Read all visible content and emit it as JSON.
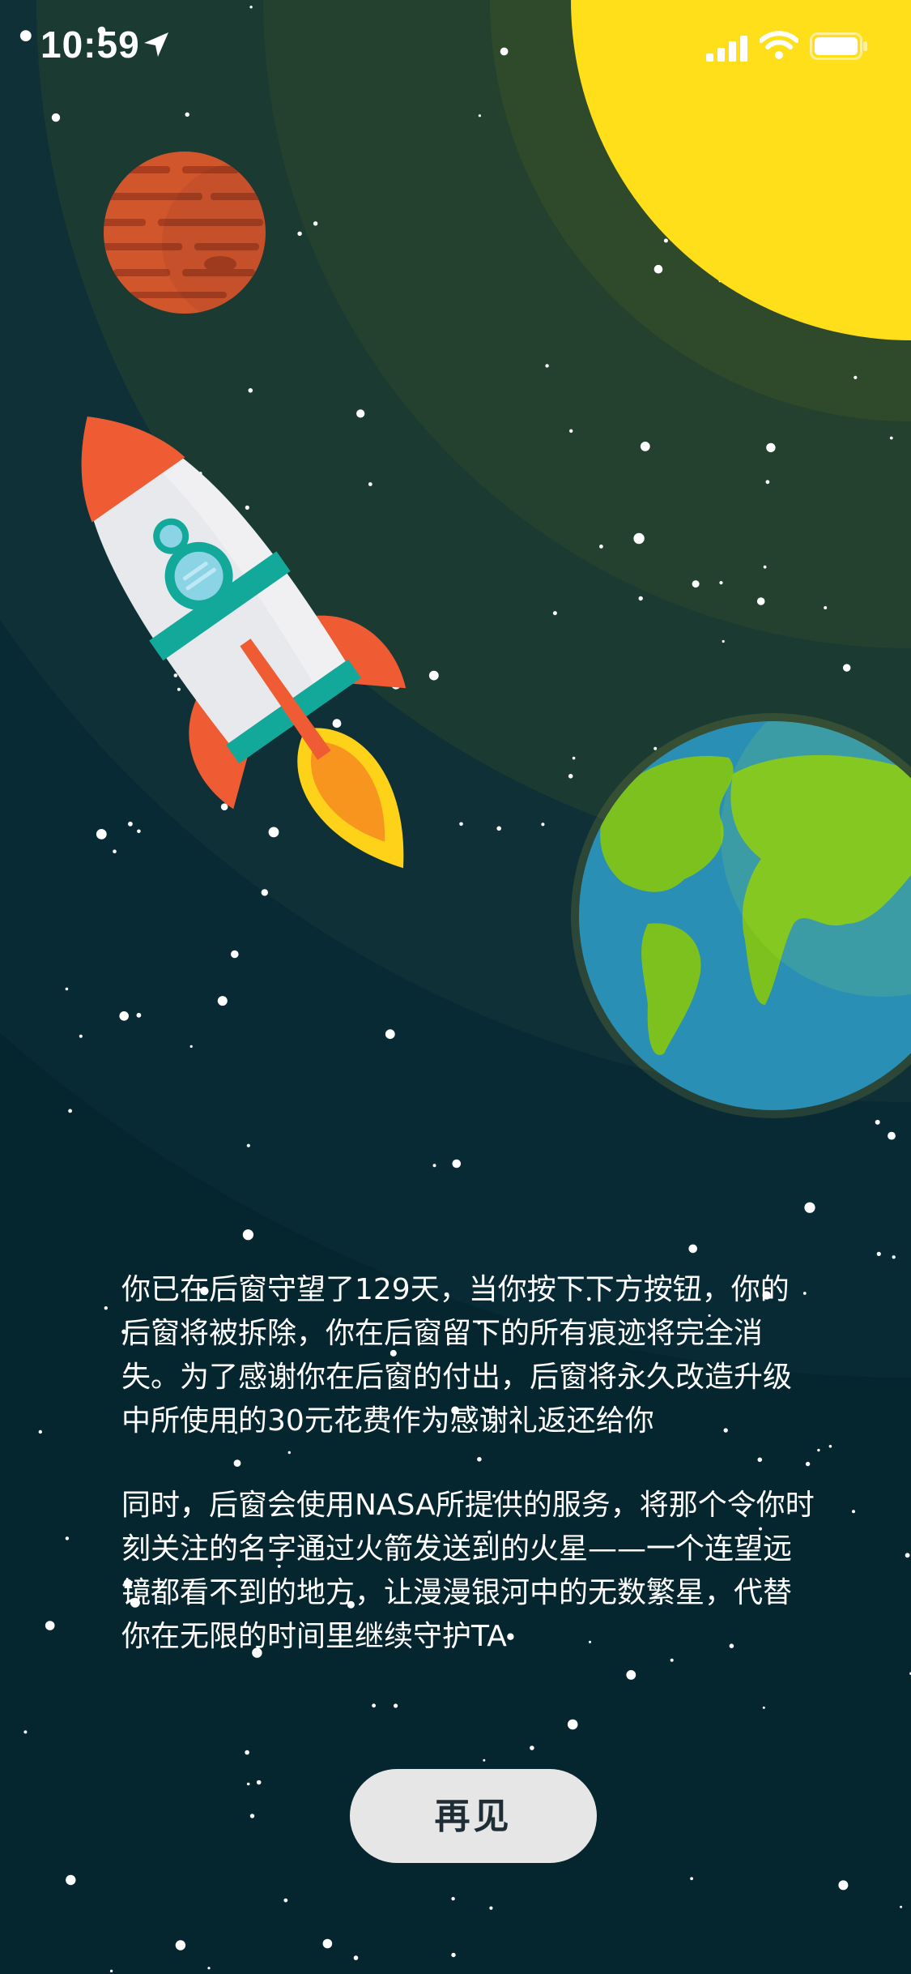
{
  "status_bar": {
    "time": "10:59",
    "location_icon": "location-arrow-icon",
    "signal_icon": "cellular-signal-icon",
    "wifi_icon": "wifi-icon",
    "battery_icon": "battery-icon"
  },
  "illustration": {
    "sun_icon": "sun-icon",
    "mars_icon": "mars-planet-icon",
    "rocket_icon": "rocket-icon",
    "earth_icon": "earth-planet-icon"
  },
  "message": {
    "paragraph_1": "你已在后窗守望了129天，当你按下下方按钮，你的后窗将被拆除，你在后窗留下的所有痕迹将完全消失。为了感谢你在后窗的付出，后窗将永久改造升级中所使用的30元花费作为感谢礼返还给你",
    "paragraph_2": "同时，后窗会使用NASA所提供的服务，将那个令你时刻关注的名字通过火箭发送到的火星——一个连望远镜都看不到的地方，让漫漫银河中的无数繁星，代替你在无限的时间里继续守护TA"
  },
  "actions": {
    "goodbye_label": "再见"
  },
  "colors": {
    "background": "#05252f",
    "sun": "#ffde1a",
    "mars": "#d2562c",
    "rocket_accent": "#ef5b33",
    "rocket_stripe": "#12a99a",
    "ocean": "#2a8fb5",
    "land": "#7dc11f",
    "button_bg": "#e6e6e6",
    "button_text": "#1f2d36"
  }
}
